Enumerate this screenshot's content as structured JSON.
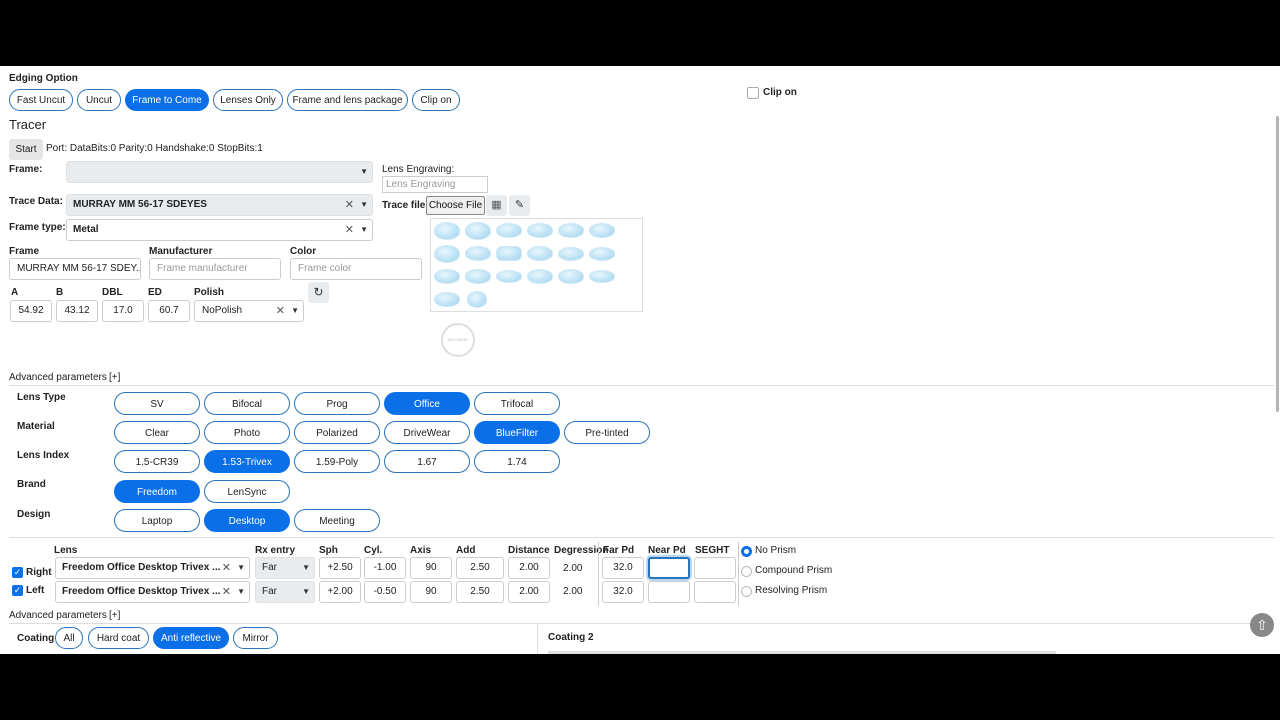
{
  "edging": {
    "title": "Edging Option",
    "options": [
      "Fast Uncut",
      "Uncut",
      "Frame to Come",
      "Lenses Only",
      "Frame and lens package",
      "Clip on"
    ],
    "selected": "Frame to Come",
    "clip_on_label": "Clip on"
  },
  "tracer": {
    "title": "Tracer",
    "start_label": "Start",
    "port_text": "Port: DataBits:0 Parity:0 Handshake:0 StopBits:1",
    "frame_label": "Frame:",
    "frame_value": "",
    "trace_data_label": "Trace Data:",
    "trace_data_value": "MURRAY MM 56-17 SDEYES",
    "frame_type_label": "Frame type:",
    "frame_type_value": "Metal",
    "lens_engraving_label": "Lens Engraving:",
    "lens_engraving_placeholder": "Lens Engraving",
    "trace_file_label": "Trace file",
    "choose_file_label": "Choose File",
    "no_image_text": "NO IMAGE"
  },
  "frame_fields": {
    "frame_label": "Frame",
    "frame_value": "MURRAY MM 56-17 SDEY...",
    "manufacturer_label": "Manufacturer",
    "manufacturer_placeholder": "Frame manufacturer",
    "color_label": "Color",
    "color_placeholder": "Frame color"
  },
  "measurements": {
    "a_label": "A",
    "a": "54.92",
    "b_label": "B",
    "b": "43.12",
    "dbl_label": "DBL",
    "dbl": "17.0",
    "ed_label": "ED",
    "ed": "60.7",
    "polish_label": "Polish",
    "polish": "NoPolish"
  },
  "advanced_label": "Advanced parameters",
  "advanced_toggle": "[+]",
  "lens_options": {
    "lens_type": {
      "label": "Lens Type",
      "options": [
        "SV",
        "Bifocal",
        "Prog",
        "Office",
        "Trifocal"
      ],
      "selected": "Office"
    },
    "material": {
      "label": "Material",
      "options": [
        "Clear",
        "Photo",
        "Polarized",
        "DriveWear",
        "BlueFilter",
        "Pre-tinted"
      ],
      "selected": "BlueFilter"
    },
    "lens_index": {
      "label": "Lens Index",
      "options": [
        "1.5-CR39",
        "1.53-Trivex",
        "1.59-Poly",
        "1.67",
        "1.74"
      ],
      "selected": "1.53-Trivex"
    },
    "brand": {
      "label": "Brand",
      "options": [
        "Freedom",
        "LenSync"
      ],
      "selected": "Freedom"
    },
    "design": {
      "label": "Design",
      "options": [
        "Laptop",
        "Desktop",
        "Meeting"
      ],
      "selected": "Desktop"
    }
  },
  "rx": {
    "headers": [
      "Lens",
      "Rx entry",
      "Sph",
      "Cyl.",
      "Axis",
      "Add",
      "Distance",
      "Degression",
      "Far Pd",
      "Near Pd",
      "SEGHT"
    ],
    "rows": [
      {
        "side": "Right",
        "checked": true,
        "lens": "Freedom Office Desktop Trivex ...",
        "rx_entry": "Far",
        "sph": "+2.50",
        "cyl": "-1.00",
        "axis": "90",
        "add": "2.50",
        "distance": "2.00",
        "degression": "2.00",
        "far_pd": "32.0",
        "near_pd": "",
        "seght": ""
      },
      {
        "side": "Left",
        "checked": true,
        "lens": "Freedom Office Desktop Trivex ...",
        "rx_entry": "Far",
        "sph": "+2.00",
        "cyl": "-0.50",
        "axis": "90",
        "add": "2.50",
        "distance": "2.00",
        "degression": "2.00",
        "far_pd": "32.0",
        "near_pd": "",
        "seght": ""
      }
    ],
    "prism": {
      "options": [
        "No Prism",
        "Compound Prism",
        "Resolving Prism"
      ],
      "selected": "No Prism"
    }
  },
  "coating": {
    "label": "Coating",
    "options": [
      "All",
      "Hard coat",
      "Anti reflective",
      "Mirror"
    ],
    "selected": "Anti reflective",
    "coating2_label": "Coating 2"
  },
  "colors": {
    "accent": "#0b6fe8",
    "border": "#2a73b8"
  }
}
